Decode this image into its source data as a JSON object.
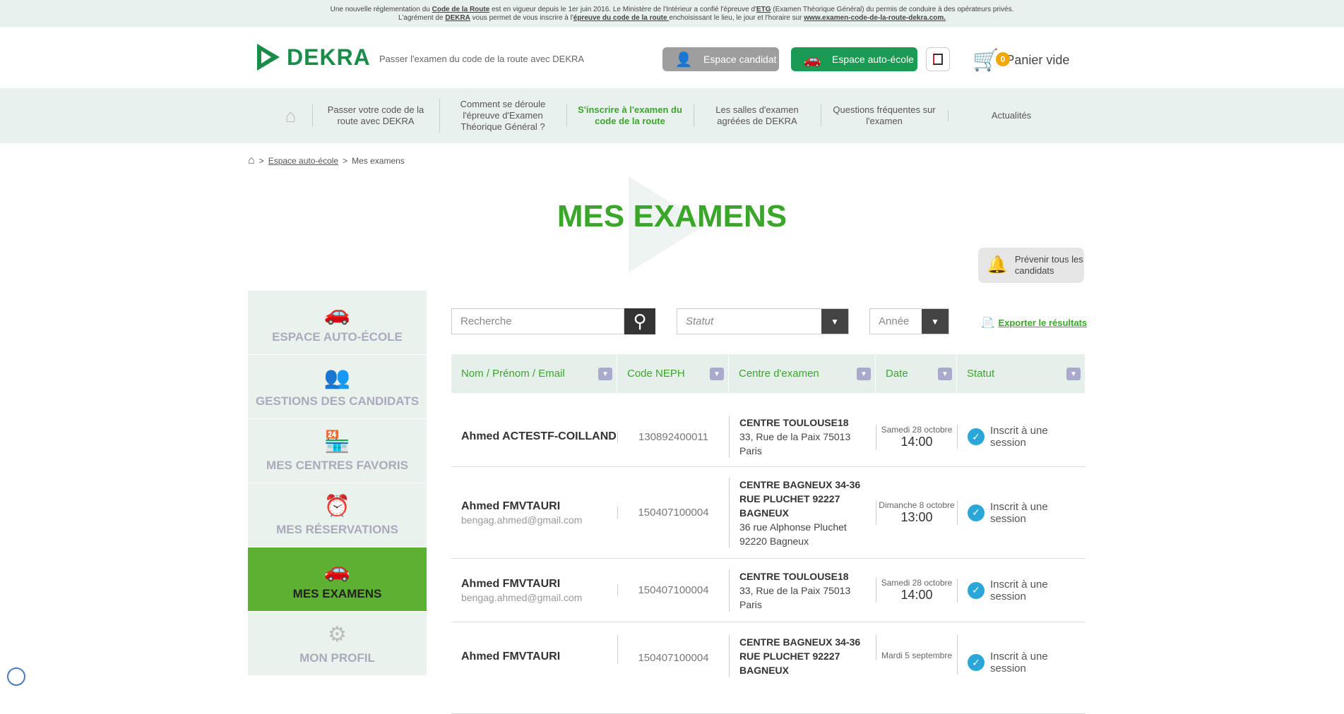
{
  "topbar": {
    "line1_a": "Une nouvelle réglementation du ",
    "line1_b": "Code de la Route",
    "line1_c": " est en vigueur depuis le 1er juin 2016. Le Ministère de l'Intérieur a confié l'épreuve d'",
    "line1_d": "ETG",
    "line1_e": " (Examen Théorique Général)  du permis de conduire à des opérateurs privés.",
    "line2_a": "L'agrément de ",
    "line2_b": "DEKRA",
    "line2_c": " vous permet de vous inscrire à l'",
    "line2_d": "épreuve du code de la route ",
    "line2_e": "enchoisissant le lieu, le jour et l'horaire sur ",
    "line2_f": "www.examen-code-de-la-route-dekra.com."
  },
  "header": {
    "logo": "DEKRA",
    "tagline": "Passer l'examen du code de la route avec DEKRA",
    "btn_candidat": "Espace candidat",
    "btn_autoecole": "Espace auto-école",
    "cart_count": "0",
    "cart_label": "Panier vide"
  },
  "nav": {
    "items": [
      {
        "label": "Passer votre code de la route avec DEKRA"
      },
      {
        "label": "Comment se déroule l'épreuve d'Examen Théorique Général ?"
      },
      {
        "label": "S'inscrire à l'examen du code de la route"
      },
      {
        "label": "Les salles d'examen agréées de DEKRA"
      },
      {
        "label": "Questions fréquentes sur l'examen"
      },
      {
        "label": "Actualités"
      }
    ]
  },
  "breadcrumb": {
    "sep1": ">",
    "link": "Espace auto-école",
    "sep2": ">",
    "current": "Mes examens"
  },
  "page": {
    "title": "MES EXAMENS",
    "notify": "Prévenir tous les candidats"
  },
  "sidebar": {
    "items": [
      {
        "label": "ESPACE AUTO-ÉCOLE"
      },
      {
        "label": "GESTIONS DES CANDIDATS"
      },
      {
        "label": "MES CENTRES FAVORIS"
      },
      {
        "label": "MES RÉSERVATIONS"
      },
      {
        "label": "MES EXAMENS"
      },
      {
        "label": "MON PROFIL"
      }
    ]
  },
  "filters": {
    "search_placeholder": "Recherche",
    "statut_placeholder": "Statut",
    "annee_placeholder": "Année",
    "export_label": "Exporter le résultats"
  },
  "table": {
    "headers": [
      "Nom / Prénom / Email",
      "Code NEPH",
      "Centre d'examen",
      "Date",
      "Statut"
    ],
    "rows": [
      {
        "name": "Ahmed ACTESTF-COILLAND",
        "email": "",
        "neph": "130892400011",
        "centre": "CENTRE TOULOUSE18",
        "addr1": "33, Rue de la Paix 75013",
        "addr2": "Paris",
        "day": "Samedi 28 octobre",
        "time": "14:00",
        "status": "Inscrit à une session"
      },
      {
        "name": "Ahmed FMVTAURI",
        "email": "bengag.ahmed@gmail.com",
        "neph": "150407100004",
        "centre": "CENTRE BAGNEUX 34-36 RUE PLUCHET 92227 BAGNEUX",
        "addr1": "36 rue Alphonse Pluchet",
        "addr2": "92220 Bagneux",
        "day": "Dimanche 8 octobre",
        "time": "13:00",
        "status": "Inscrit à une session"
      },
      {
        "name": "Ahmed FMVTAURI",
        "email": "bengag.ahmed@gmail.com",
        "neph": "150407100004",
        "centre": "CENTRE TOULOUSE18",
        "addr1": "33, Rue de la Paix 75013",
        "addr2": "Paris",
        "day": "Samedi 28 octobre",
        "time": "14:00",
        "status": "Inscrit à une session"
      },
      {
        "name": "Ahmed FMVTAURI",
        "email": "",
        "neph": "150407100004",
        "centre": "CENTRE BAGNEUX 34-36 RUE PLUCHET 92227 BAGNEUX",
        "addr1": "",
        "addr2": "",
        "day": "Mardi 5 septembre",
        "time": "",
        "status": "Inscrit à une session"
      }
    ]
  },
  "colors": {
    "brand_green": "#1a8c4a",
    "accent_green": "#3aa62a",
    "status_blue": "#2aa6d9"
  },
  "icons": [
    "user-icon",
    "car-icon",
    "logout-icon",
    "cart-icon",
    "home-icon",
    "bell-icon",
    "search-icon",
    "export-icon",
    "check-icon"
  ]
}
